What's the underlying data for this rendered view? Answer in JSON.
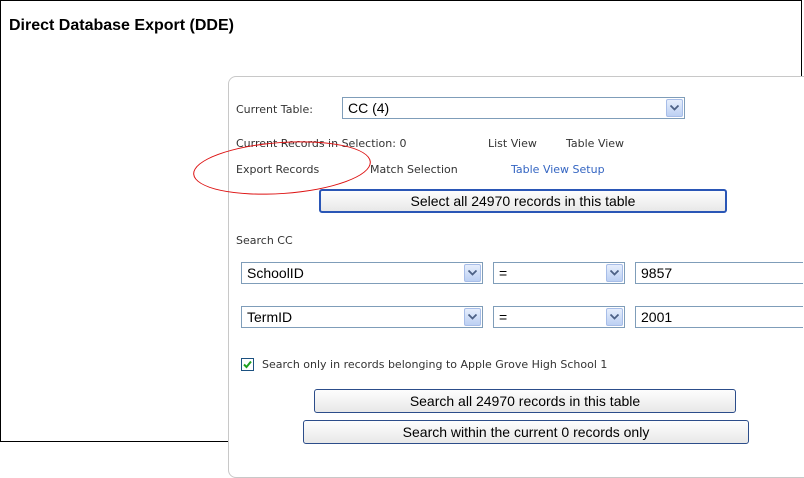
{
  "page": {
    "title": "Direct Database Export (DDE)"
  },
  "table_selector": {
    "label": "Current Table:",
    "value": "CC (4)"
  },
  "selection_info": {
    "text": "Current Records in Selection: 0"
  },
  "view_links": {
    "list_view": "List View",
    "table_view": "Table View"
  },
  "actions": {
    "export_records": "Export Records",
    "match_selection": "Match Selection",
    "table_view_setup": "Table View Setup"
  },
  "select_all_button": "Select all 24970 records in this table",
  "search": {
    "heading": "Search CC",
    "rows": [
      {
        "field": "SchoolID",
        "operator": "=",
        "value": "9857"
      },
      {
        "field": "TermID",
        "operator": "=",
        "value": "2001"
      }
    ],
    "checkbox_label": "Search only in records belonging to Apple Grove High School 1",
    "checkbox_checked": true,
    "search_all_button": "Search all 24970 records in this table",
    "search_within_button": "Search within the current 0 records only"
  },
  "colors": {
    "link": "#3465c2",
    "annotation": "#dd1111",
    "focus_border": "#2a56b6"
  }
}
